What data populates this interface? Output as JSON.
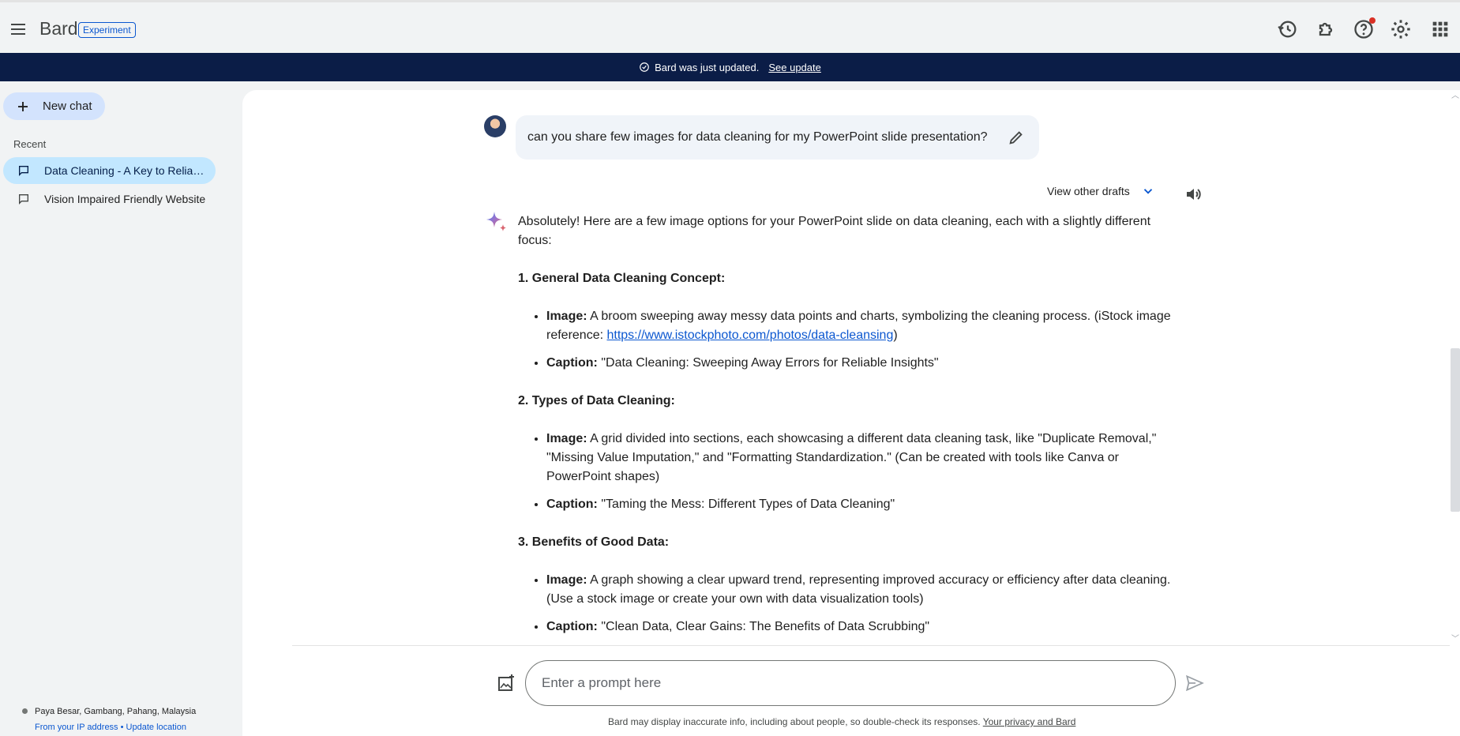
{
  "header": {
    "brand": "Bard",
    "badge": "Experiment",
    "icons": [
      "history-icon",
      "extensions-icon",
      "help-icon",
      "settings-icon",
      "apps-icon"
    ]
  },
  "banner": {
    "text": "Bard was just updated.",
    "link": "See update"
  },
  "sidebar": {
    "new_chat": "New chat",
    "recent_label": "Recent",
    "items": [
      {
        "label": "Data Cleaning - A Key to Reliable Insights",
        "active": true
      },
      {
        "label": "Vision Impaired Friendly Website",
        "active": false
      }
    ],
    "location": "Paya Besar, Gambang, Pahang, Malaysia",
    "location_source": "From your IP address",
    "location_separator": "•",
    "update_location": "Update location"
  },
  "conversation": {
    "user_prompt": "can you share few images for data cleaning for my PowerPoint slide presentation?",
    "view_drafts": "View other drafts",
    "intro": "Absolutely! Here are a few image options for your PowerPoint slide on data cleaning, each with a slightly different focus:",
    "sections": [
      {
        "heading": "1. General Data Cleaning Concept:",
        "image_label": "Image:",
        "image_text": "A broom sweeping away messy data points and charts, symbolizing the cleaning process. (iStock image reference: ",
        "image_link": "https://www.istockphoto.com/photos/data-cleansing",
        "image_tail": ")",
        "caption_label": "Caption:",
        "caption": "\"Data Cleaning: Sweeping Away Errors for Reliable Insights\""
      },
      {
        "heading": "2. Types of Data Cleaning:",
        "image_label": "Image:",
        "image_text": "A grid divided into sections, each showcasing a different data cleaning task, like \"Duplicate Removal,\" \"Missing Value Imputation,\" and \"Formatting Standardization.\" (Can be created with tools like Canva or PowerPoint shapes)",
        "caption_label": "Caption:",
        "caption": "\"Taming the Mess: Different Types of Data Cleaning\""
      },
      {
        "heading": "3. Benefits of Good Data:",
        "image_label": "Image:",
        "image_text": "A graph showing a clear upward trend, representing improved accuracy or efficiency after data cleaning. (Use a stock image or create your own with data visualization tools)",
        "caption_label": "Caption:",
        "caption": "\"Clean Data, Clear Gains: The Benefits of Data Scrubbing\""
      }
    ]
  },
  "input": {
    "placeholder": "Enter a prompt here",
    "value": ""
  },
  "footer": {
    "disclaimer": "Bard may display inaccurate info, including about people, so double-check its responses.",
    "privacy_link": "Your privacy and Bard"
  },
  "colors": {
    "accent": "#0b57d0",
    "banner_bg": "#0b1d47",
    "active_item_bg": "#c2e7ff",
    "new_chat_bg": "#d3e3fd",
    "notification": "#d93025"
  }
}
